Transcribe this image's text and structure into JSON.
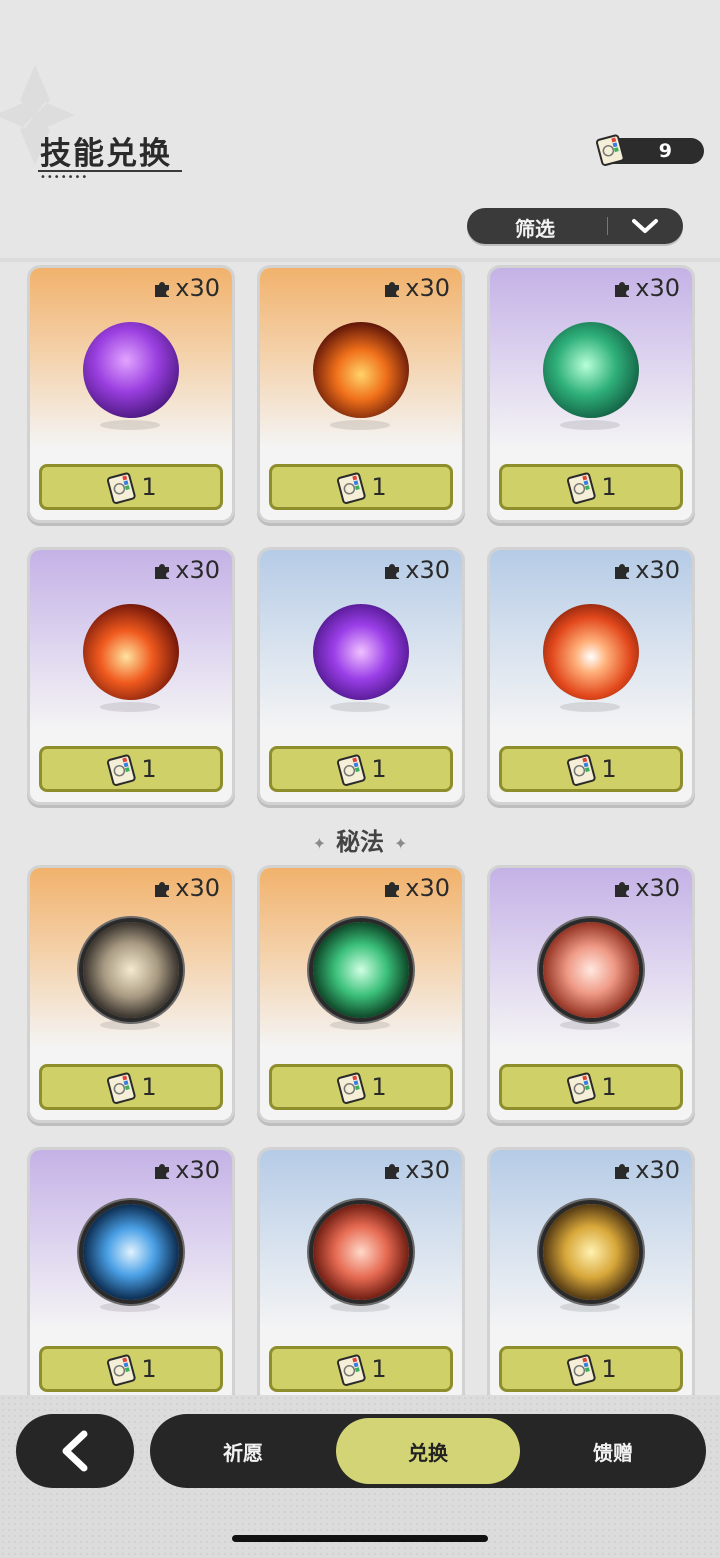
{
  "header": {
    "title": "技能兑换",
    "currency_value": "9"
  },
  "filter": {
    "label": "筛选"
  },
  "section_label": "秘法",
  "items": [
    {
      "qty": "x30",
      "price": "1",
      "bg": "orange",
      "orb": "radial-gradient(circle at 45% 40%, #e2a4ff 0%, #9a3fe0 40%, #3a0f6a 85%)"
    },
    {
      "qty": "x30",
      "price": "1",
      "bg": "orange",
      "orb": "radial-gradient(circle at 50% 55%, #ffd36a 0%, #f0701a 35%, #5a1208 75%, #1e0503 95%)"
    },
    {
      "qty": "x30",
      "price": "1",
      "bg": "purple",
      "orb": "radial-gradient(circle at 45% 45%, #b8ffd8 0%, #2fb07a 40%, #0a4a34 85%)"
    },
    {
      "qty": "x30",
      "price": "1",
      "bg": "purple",
      "orb": "radial-gradient(circle at 45% 55%, #ffe3a0 0%, #f05a1e 35%, #6a1208 75%, #210505 95%)"
    },
    {
      "qty": "x30",
      "price": "1",
      "bg": "blue",
      "orb": "radial-gradient(circle at 50% 50%, #f0c0ff 0%, #9b3fe8 40%, #3e0e78 85%)"
    },
    {
      "qty": "x30",
      "price": "1",
      "bg": "blue",
      "orb": "radial-gradient(circle at 50% 55%, #ffffff 0%, #ffb07a 22%, #e2481c 55%, #5a1206 92%)"
    },
    {
      "qty": "x30",
      "price": "1",
      "bg": "orange",
      "orb": "radial-gradient(circle at 50% 50%, #f5ebd0 0%, #a89a82 40%, #3c3630 70%, #1a1a1a 92%)"
    },
    {
      "qty": "x30",
      "price": "1",
      "bg": "orange",
      "orb": "radial-gradient(circle at 50% 50%, #d0ffe2 0%, #3bc07a 38%, #0f4a2a 70%, #151515 92%)"
    },
    {
      "qty": "x30",
      "price": "1",
      "bg": "purple",
      "orb": "radial-gradient(circle at 50% 50%, #ffe8e0 0%, #ef9a86 35%, #9a3a2a 68%, #161616 92%)"
    },
    {
      "qty": "x30",
      "price": "1",
      "bg": "purple",
      "orb": "radial-gradient(circle at 50% 50%, #e0f2ff 0%, #4aa0e6 35%, #10345a 68%, #121212 92%)"
    },
    {
      "qty": "x30",
      "price": "1",
      "bg": "blue",
      "orb": "radial-gradient(circle at 50% 50%, #ffd8c8 0%, #e66a52 38%, #7a2418 68%, #151515 92%)"
    },
    {
      "qty": "x30",
      "price": "1",
      "bg": "blue",
      "orb": "radial-gradient(circle at 50% 50%, #fff2b0 0%, #d8a73a 38%, #5e4216 68%, #141414 92%)"
    }
  ],
  "bottom_nav": {
    "tabs": [
      "祈愿",
      "兑换",
      "馈赠"
    ],
    "active": 1
  }
}
